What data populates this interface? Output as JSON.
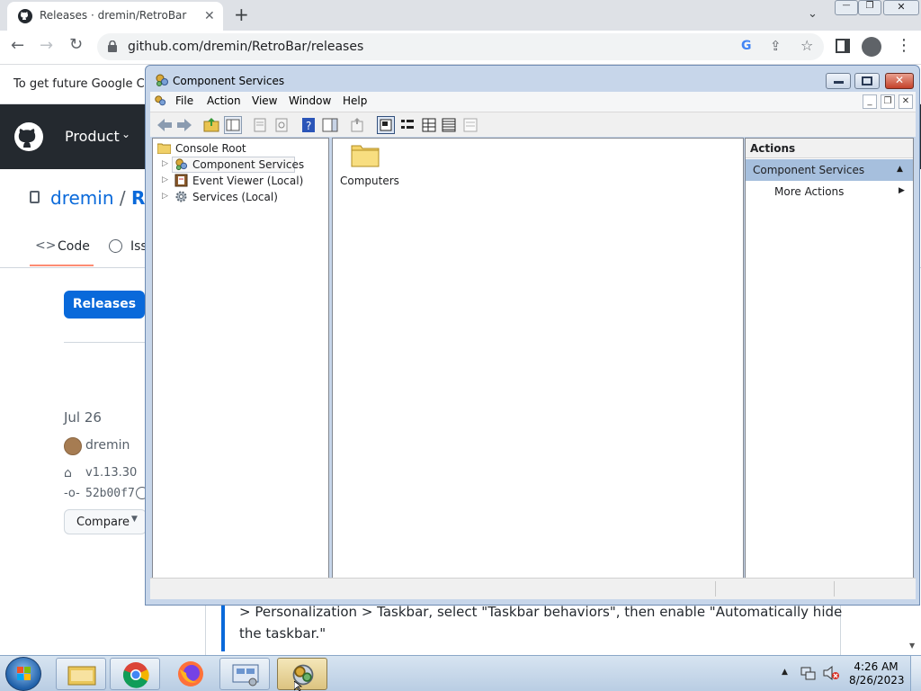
{
  "browser": {
    "tab_title": "Releases · dremin/RetroBar",
    "url": "github.com/dremin/RetroBar/releases",
    "infobar_text": "To get future Google Chro"
  },
  "github": {
    "product_menu": "Product",
    "repo_owner": "dremin",
    "repo_separator": "/",
    "repo_name_partial": "Ret",
    "code_tab": "Code",
    "issues_tab_partial": "Iss",
    "releases_button": "Releases",
    "release_date": "Jul 26",
    "author": "dremin",
    "tag": "v1.13.30",
    "commit": "52b00f7",
    "compare_button": "Compare",
    "quote_line1": "> Personalization > Taskbar, select \"Taskbar behaviors\", then enable \"Automatically hide",
    "quote_line2": "the taskbar.\""
  },
  "mmc": {
    "title": "Component Services",
    "menu": [
      "File",
      "Action",
      "View",
      "Window",
      "Help"
    ],
    "tree": {
      "root": "Console Root",
      "items": [
        "Component Services",
        "Event Viewer (Local)",
        "Services (Local)"
      ]
    },
    "content_item": "Computers",
    "actions": {
      "header": "Actions",
      "section": "Component Services",
      "more_actions": "More Actions"
    }
  },
  "taskbar": {
    "time": "4:26 AM",
    "date": "8/26/2023"
  },
  "colors": {
    "github_blue": "#0969da",
    "mmc_frame": "#c7d6ea",
    "actions_section": "#a6bfdd"
  }
}
